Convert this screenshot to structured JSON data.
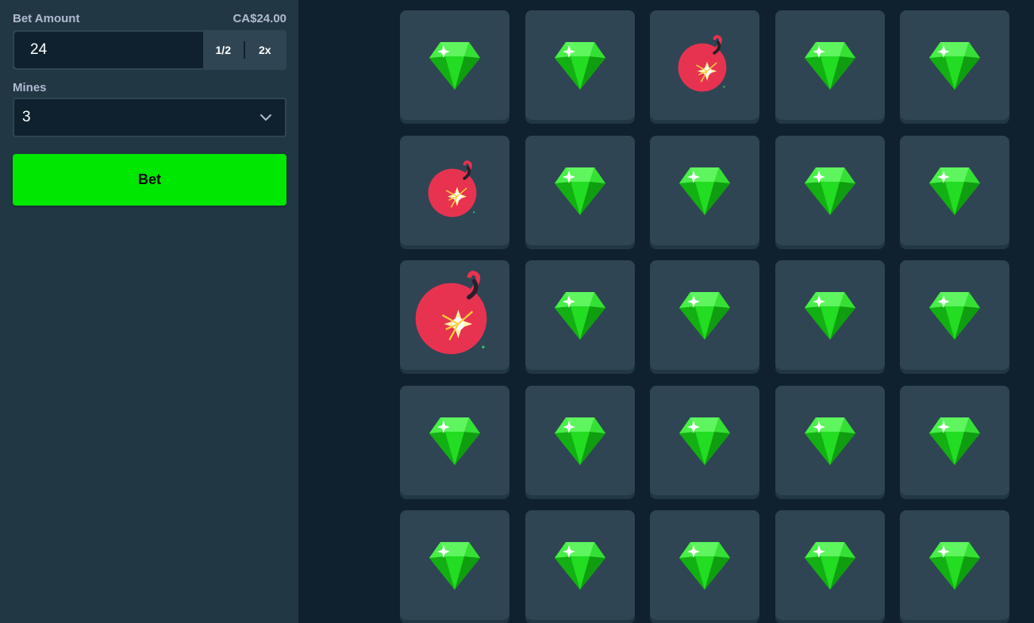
{
  "sidebar": {
    "bet_amount_label": "Bet Amount",
    "bet_amount_value": "CA$24.00",
    "bet_input_value": "24",
    "half_label": "1/2",
    "double_label": "2x",
    "mines_label": "Mines",
    "mines_selected": "3",
    "bet_button_label": "Bet"
  },
  "colors": {
    "background": "#0f212e",
    "sidebar": "#213743",
    "tile": "#2f4553",
    "accent_green": "#00e701",
    "gem": "#1fd11f",
    "mine": "#e83350"
  },
  "board": {
    "rows": 5,
    "cols": 5,
    "tiles": [
      "gem",
      "gem",
      "mine",
      "gem",
      "gem",
      "mine",
      "gem",
      "gem",
      "gem",
      "gem",
      "mine-revealed",
      "gem",
      "gem",
      "gem",
      "gem",
      "gem",
      "gem",
      "gem",
      "gem",
      "gem",
      "gem",
      "gem",
      "gem",
      "gem",
      "gem"
    ]
  }
}
